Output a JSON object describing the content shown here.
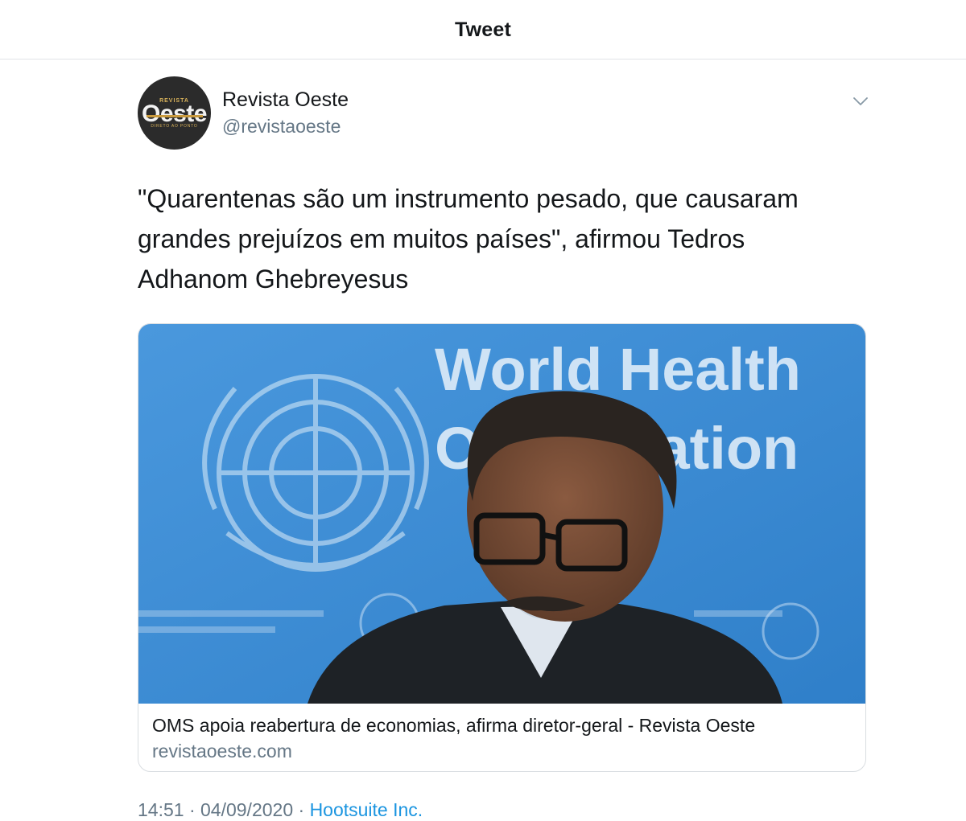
{
  "header": {
    "title": "Tweet"
  },
  "tweet": {
    "avatar": {
      "brand_small": "REVISTA",
      "brand": "Oeste",
      "tagline": "DIRETO AO PONTO"
    },
    "author_name": "Revista Oeste",
    "author_handle": "@revistaoeste",
    "text": "\"Quarentenas são um instrumento pesado, que causaram grandes prejuízos em muitos países\", afirmou Tedros Adhanom Ghebreyesus",
    "card": {
      "image": {
        "sign_line1": "World Health",
        "sign_line2": "Organization"
      },
      "title": "OMS apoia reabertura de economias, afirma diretor-geral - Revista Oeste",
      "domain": "revistaoeste.com"
    },
    "timestamp": "14:51 · 04/09/2020 ·",
    "via": "Hootsuite Inc."
  },
  "colors": {
    "text_primary": "#14171a",
    "text_secondary": "#657786",
    "link": "#1b95e0",
    "card_bg": "#3d8fd6",
    "border": "#e1e4e8"
  },
  "icons": {
    "more": "chevron-down-icon"
  }
}
